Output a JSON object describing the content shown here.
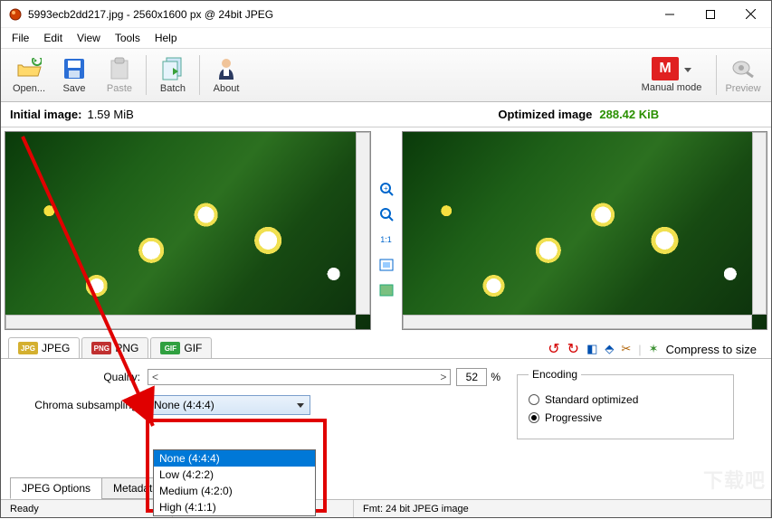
{
  "window": {
    "title": "5993ecb2dd217.jpg - 2560x1600 px @ 24bit JPEG"
  },
  "menu": {
    "file": "File",
    "edit": "Edit",
    "view": "View",
    "tools": "Tools",
    "help": "Help"
  },
  "toolbar": {
    "open": "Open...",
    "save": "Save",
    "paste": "Paste",
    "batch": "Batch",
    "about": "About",
    "manual": "Manual mode",
    "preview": "Preview"
  },
  "imageHeader": {
    "initialLabel": "Initial image:",
    "initialSize": "1.59 MiB",
    "optimizedLabel": "Optimized image",
    "optimizedSize": "288.42 KiB"
  },
  "midTools": {
    "oneToOne": "1:1"
  },
  "typeTabs": {
    "jpeg": "JPEG",
    "png": "PNG",
    "gif": "GIF"
  },
  "rightTools": {
    "compress": "Compress to size"
  },
  "controls": {
    "qualityLabel": "Quality:",
    "qualityValue": "52",
    "percent": "%",
    "chromaLabel": "Chroma subsampling:",
    "chromaValue": "None (4:4:4)",
    "chromaOptions": [
      "None (4:4:4)",
      "Low (4:2:2)",
      "Medium (4:2:0)",
      "High (4:1:1)"
    ]
  },
  "encoding": {
    "legend": "Encoding",
    "standard": "Standard optimized",
    "progressive": "Progressive"
  },
  "bottomTabs": {
    "jpegOptions": "JPEG Options",
    "metadata": "Metadata"
  },
  "status": {
    "ready": "Ready",
    "fmt": "Fmt: 24 bit JPEG image"
  },
  "watermark": "下载吧"
}
